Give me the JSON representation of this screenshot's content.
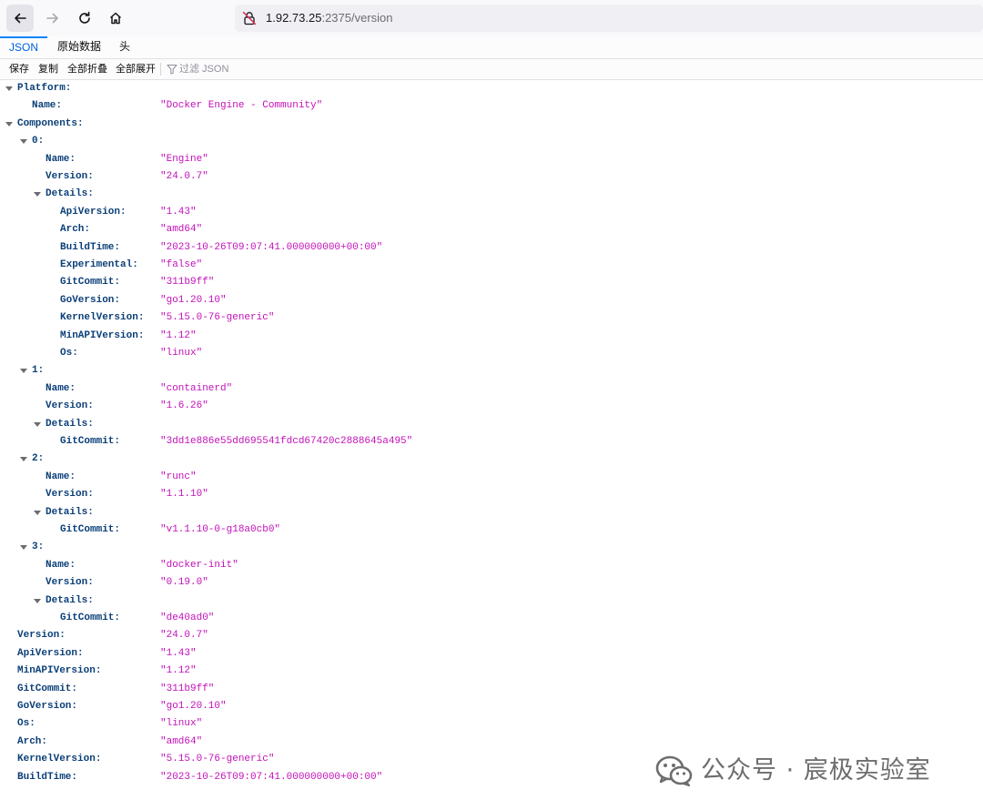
{
  "browser": {
    "url_host": "1.92.73.25",
    "url_rest": ":2375/version"
  },
  "tabs": [
    {
      "label": "JSON",
      "active": true
    },
    {
      "label": "原始数据",
      "active": false
    },
    {
      "label": "头",
      "active": false
    }
  ],
  "actions": {
    "save": "保存",
    "copy": "复制",
    "collapse_all": "全部折叠",
    "expand_all": "全部展开",
    "filter_placeholder": "过滤 JSON"
  },
  "json_rows": [
    {
      "key": "Platform:",
      "value": "",
      "depth": 0,
      "expandable": true
    },
    {
      "key": "Name:",
      "value": "\"Docker Engine - Community\"",
      "depth": 1,
      "expandable": false
    },
    {
      "key": "Components:",
      "value": "",
      "depth": 0,
      "expandable": true
    },
    {
      "key": "0:",
      "value": "",
      "depth": 1,
      "expandable": true
    },
    {
      "key": "Name:",
      "value": "\"Engine\"",
      "depth": 2,
      "expandable": false
    },
    {
      "key": "Version:",
      "value": "\"24.0.7\"",
      "depth": 2,
      "expandable": false
    },
    {
      "key": "Details:",
      "value": "",
      "depth": 2,
      "expandable": true
    },
    {
      "key": "ApiVersion:",
      "value": "\"1.43\"",
      "depth": 3,
      "expandable": false
    },
    {
      "key": "Arch:",
      "value": "\"amd64\"",
      "depth": 3,
      "expandable": false
    },
    {
      "key": "BuildTime:",
      "value": "\"2023-10-26T09:07:41.000000000+00:00\"",
      "depth": 3,
      "expandable": false
    },
    {
      "key": "Experimental:",
      "value": "\"false\"",
      "depth": 3,
      "expandable": false
    },
    {
      "key": "GitCommit:",
      "value": "\"311b9ff\"",
      "depth": 3,
      "expandable": false
    },
    {
      "key": "GoVersion:",
      "value": "\"go1.20.10\"",
      "depth": 3,
      "expandable": false
    },
    {
      "key": "KernelVersion:",
      "value": "\"5.15.0-76-generic\"",
      "depth": 3,
      "expandable": false
    },
    {
      "key": "MinAPIVersion:",
      "value": "\"1.12\"",
      "depth": 3,
      "expandable": false
    },
    {
      "key": "Os:",
      "value": "\"linux\"",
      "depth": 3,
      "expandable": false
    },
    {
      "key": "1:",
      "value": "",
      "depth": 1,
      "expandable": true
    },
    {
      "key": "Name:",
      "value": "\"containerd\"",
      "depth": 2,
      "expandable": false
    },
    {
      "key": "Version:",
      "value": "\"1.6.26\"",
      "depth": 2,
      "expandable": false
    },
    {
      "key": "Details:",
      "value": "",
      "depth": 2,
      "expandable": true
    },
    {
      "key": "GitCommit:",
      "value": "\"3dd1e886e55dd695541fdcd67420c2888645a495\"",
      "depth": 3,
      "expandable": false
    },
    {
      "key": "2:",
      "value": "",
      "depth": 1,
      "expandable": true
    },
    {
      "key": "Name:",
      "value": "\"runc\"",
      "depth": 2,
      "expandable": false
    },
    {
      "key": "Version:",
      "value": "\"1.1.10\"",
      "depth": 2,
      "expandable": false
    },
    {
      "key": "Details:",
      "value": "",
      "depth": 2,
      "expandable": true
    },
    {
      "key": "GitCommit:",
      "value": "\"v1.1.10-0-g18a0cb0\"",
      "depth": 3,
      "expandable": false
    },
    {
      "key": "3:",
      "value": "",
      "depth": 1,
      "expandable": true
    },
    {
      "key": "Name:",
      "value": "\"docker-init\"",
      "depth": 2,
      "expandable": false
    },
    {
      "key": "Version:",
      "value": "\"0.19.0\"",
      "depth": 2,
      "expandable": false
    },
    {
      "key": "Details:",
      "value": "",
      "depth": 2,
      "expandable": true
    },
    {
      "key": "GitCommit:",
      "value": "\"de40ad0\"",
      "depth": 3,
      "expandable": false
    },
    {
      "key": "Version:",
      "value": "\"24.0.7\"",
      "depth": 0,
      "expandable": false
    },
    {
      "key": "ApiVersion:",
      "value": "\"1.43\"",
      "depth": 0,
      "expandable": false
    },
    {
      "key": "MinAPIVersion:",
      "value": "\"1.12\"",
      "depth": 0,
      "expandable": false
    },
    {
      "key": "GitCommit:",
      "value": "\"311b9ff\"",
      "depth": 0,
      "expandable": false
    },
    {
      "key": "GoVersion:",
      "value": "\"go1.20.10\"",
      "depth": 0,
      "expandable": false
    },
    {
      "key": "Os:",
      "value": "\"linux\"",
      "depth": 0,
      "expandable": false
    },
    {
      "key": "Arch:",
      "value": "\"amd64\"",
      "depth": 0,
      "expandable": false
    },
    {
      "key": "KernelVersion:",
      "value": "\"5.15.0-76-generic\"",
      "depth": 0,
      "expandable": false
    },
    {
      "key": "BuildTime:",
      "value": "\"2023-10-26T09:07:41.000000000+00:00\"",
      "depth": 0,
      "expandable": false
    }
  ],
  "watermark": {
    "text": "公众号 · 宸极实验室",
    "icon": "wechat-logo-icon"
  },
  "colors": {
    "key": "#0b3f78",
    "string_value": "#c211b9",
    "active_tab": "#0060df"
  }
}
